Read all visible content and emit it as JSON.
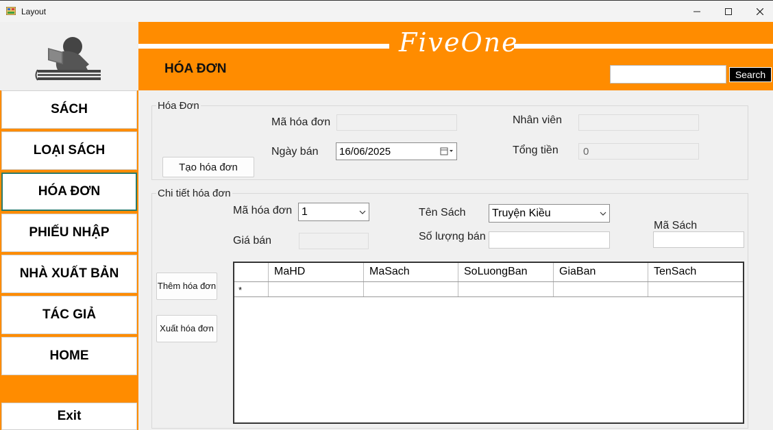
{
  "window": {
    "title": "Layout"
  },
  "header": {
    "brand": "FiveOne",
    "page_title": "HÓA ĐƠN",
    "search_placeholder": "",
    "search_label": "Search"
  },
  "sidebar": {
    "items": [
      {
        "label": "SÁCH"
      },
      {
        "label": "LOẠI SÁCH"
      },
      {
        "label": "HÓA ĐƠN",
        "active": true
      },
      {
        "label": "PHIẾU NHẬP"
      },
      {
        "label": "NHÀ XUẤT BẢN"
      },
      {
        "label": "TÁC GIẢ"
      },
      {
        "label": "HOME"
      }
    ],
    "exit_label": "Exit"
  },
  "invoice": {
    "group_title": "Hóa Đơn",
    "ma_hoa_don_label": "Mã hóa đơn",
    "ma_hoa_don_value": "",
    "ngay_ban_label": "Ngày bán",
    "ngay_ban_value": "16/06/2025",
    "nhan_vien_label": "Nhân viên",
    "nhan_vien_value": "",
    "tong_tien_label": "Tổng tiền",
    "tong_tien_value": "0",
    "create_button": "Tạo hóa đơn"
  },
  "detail": {
    "group_title": "Chi tiết hóa đơn",
    "ma_hoa_don_label": "Mã hóa đơn",
    "ma_hoa_don_value": "1",
    "gia_ban_label": "Giá bán",
    "gia_ban_value": "",
    "ten_sach_label": "Tên Sách",
    "ten_sach_value": "Truyện Kiều",
    "so_luong_label": "Số lượng bán",
    "so_luong_value": "",
    "ma_sach_label": "Mã Sách",
    "ma_sach_value": "",
    "add_button": "Thêm hóa đơn",
    "export_button": "Xuất hóa đơn"
  },
  "grid": {
    "columns": [
      "MaHD",
      "MaSach",
      "SoLuongBan",
      "GiaBan",
      "TenSach"
    ],
    "new_row_marker": "*"
  },
  "colors": {
    "accent": "#ff8c00",
    "header_text": "#ffffff"
  }
}
